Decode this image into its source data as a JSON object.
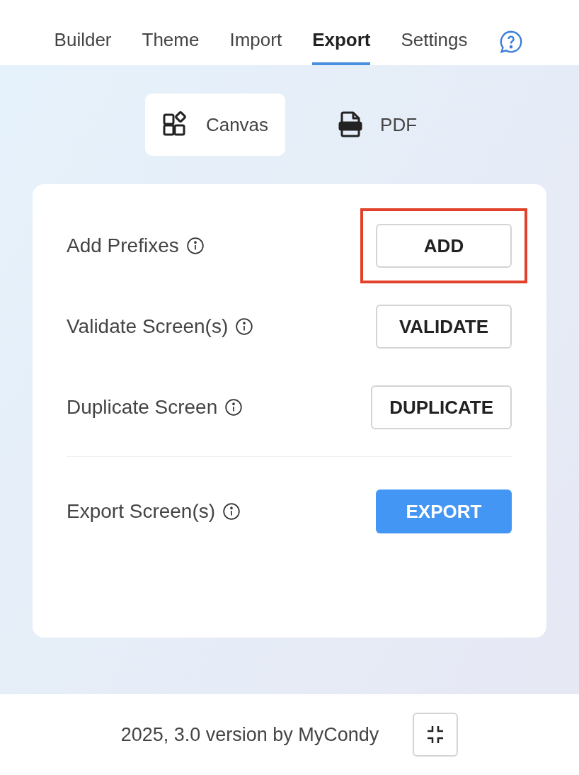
{
  "tabs": [
    {
      "label": "Builder",
      "selected": false
    },
    {
      "label": "Theme",
      "selected": false
    },
    {
      "label": "Import",
      "selected": false
    },
    {
      "label": "Export",
      "selected": true
    },
    {
      "label": "Settings",
      "selected": false
    }
  ],
  "modes": [
    {
      "label": "Canvas",
      "kind": "canvas",
      "selected": true
    },
    {
      "label": "PDF",
      "kind": "pdf",
      "selected": false
    }
  ],
  "actions": [
    {
      "label": "Add Prefixes",
      "button": "ADD",
      "kind": "outline",
      "highlighted": true,
      "divider_before": false
    },
    {
      "label": "Validate Screen(s)",
      "button": "VALIDATE",
      "kind": "outline",
      "highlighted": false,
      "divider_before": false
    },
    {
      "label": "Duplicate Screen",
      "button": "DUPLICATE",
      "kind": "outline",
      "highlighted": false,
      "divider_before": false
    },
    {
      "label": "Export Screen(s)",
      "button": "EXPORT",
      "kind": "primary",
      "highlighted": false,
      "divider_before": true
    }
  ],
  "footer": {
    "text": "2025, 3.0 version by MyCondy"
  }
}
